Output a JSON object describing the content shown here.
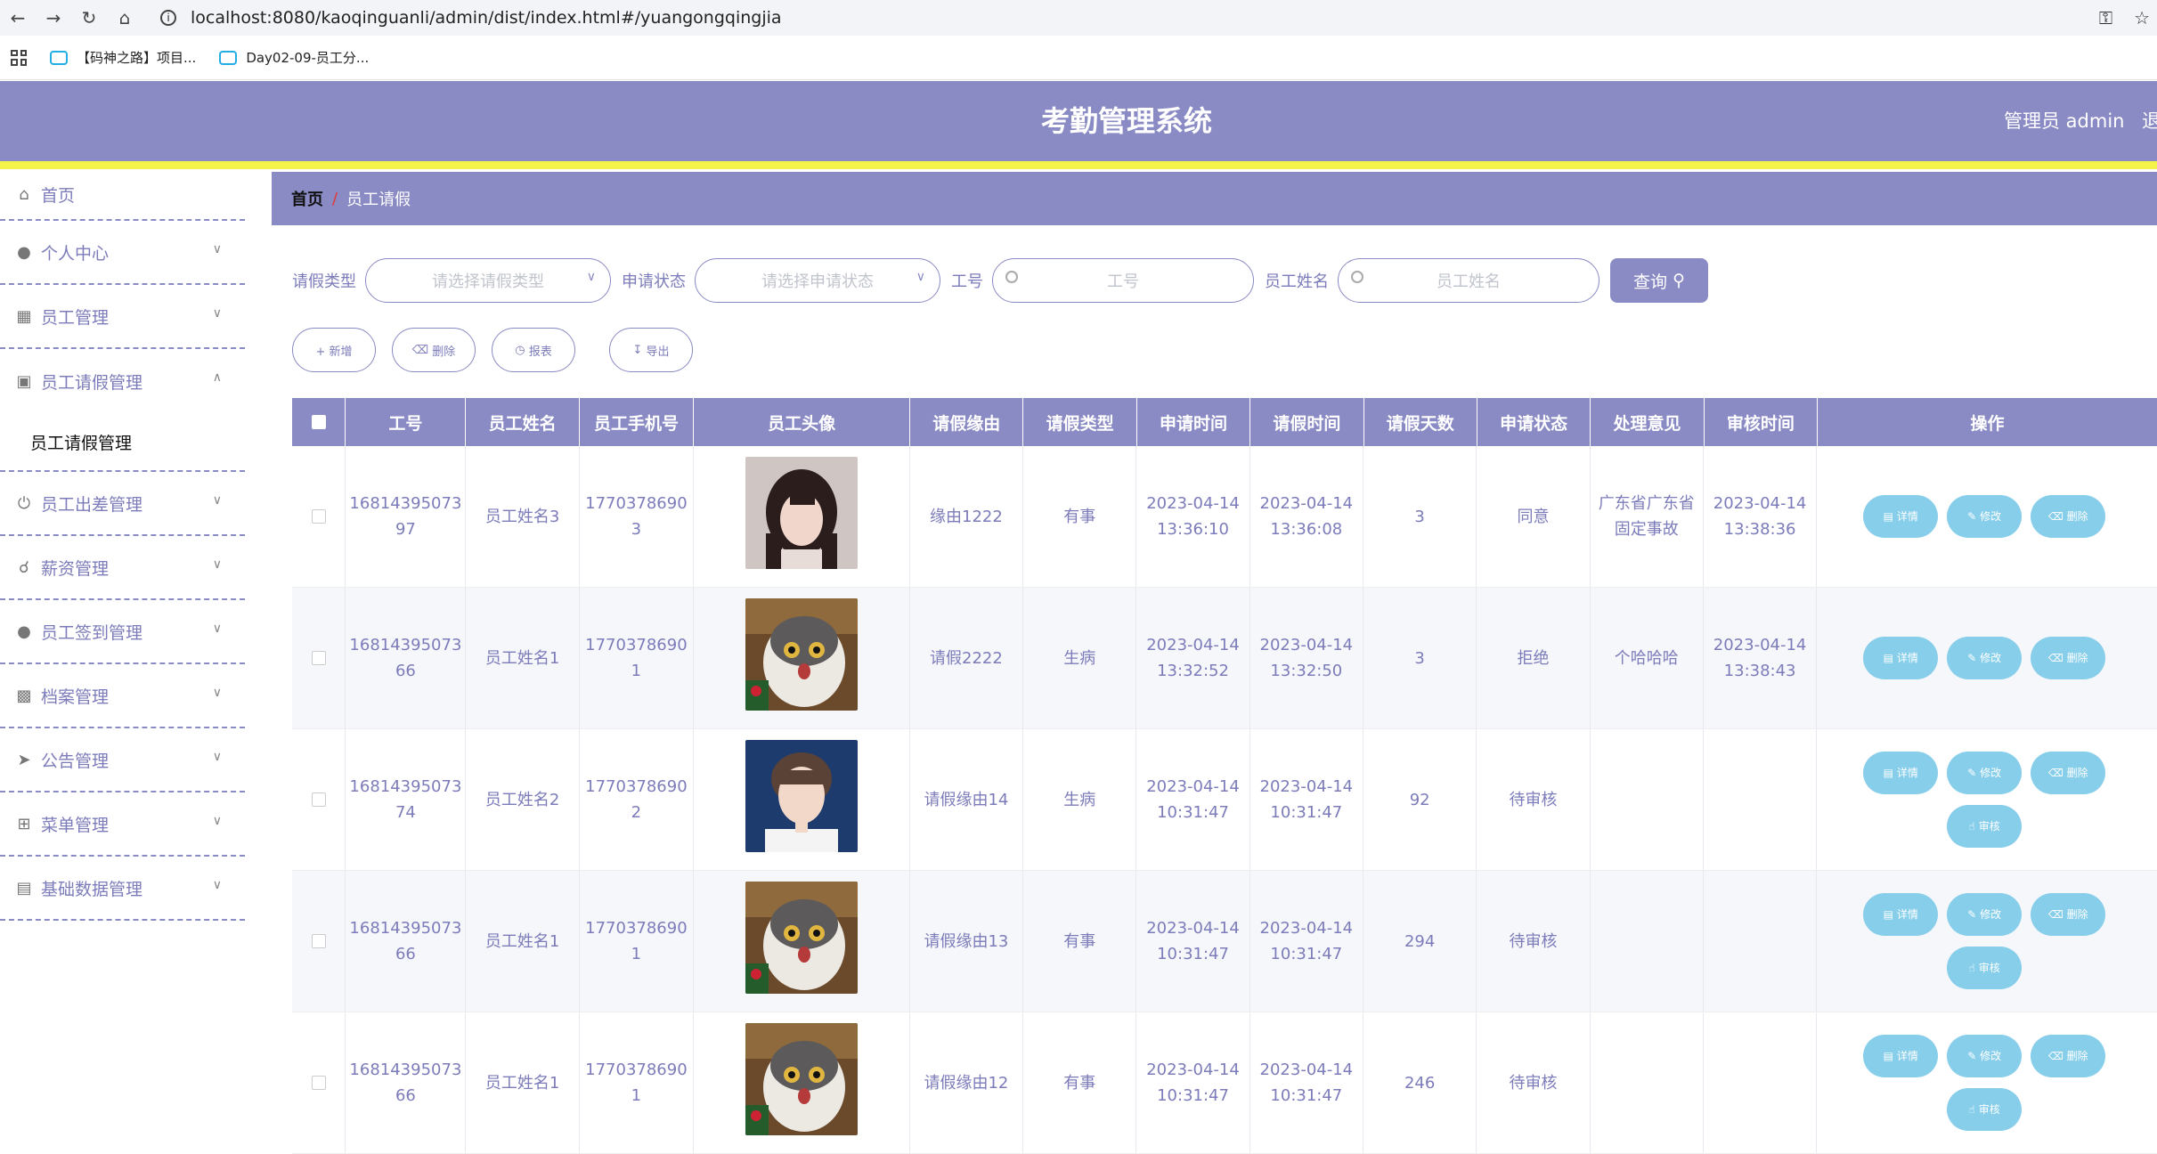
{
  "browser": {
    "url": "localhost:8080/kaoqinguanli/admin/dist/index.html#/yuangongqingjia",
    "bookmarks": [
      "【码神之路】项目...",
      "Day02-09-员工分..."
    ]
  },
  "header": {
    "title": "考勤管理系统",
    "admin": "管理员 admin",
    "logout": "退"
  },
  "sidebar": {
    "items": [
      {
        "label": "首页",
        "icon": "home-icon"
      },
      {
        "label": "个人中心",
        "icon": "user-icon"
      },
      {
        "label": "员工管理",
        "icon": "grid-icon"
      },
      {
        "label": "员工请假管理",
        "icon": "briefcase-icon"
      },
      {
        "label": "员工出差管理",
        "icon": "power-icon"
      },
      {
        "label": "薪资管理",
        "icon": "bell-off-icon"
      },
      {
        "label": "员工签到管理",
        "icon": "user-icon"
      },
      {
        "label": "档案管理",
        "icon": "printer-icon"
      },
      {
        "label": "公告管理",
        "icon": "send-icon"
      },
      {
        "label": "菜单管理",
        "icon": "crop-icon"
      },
      {
        "label": "基础数据管理",
        "icon": "clipboard-icon"
      }
    ],
    "submenu": "员工请假管理"
  },
  "breadcrumb": {
    "home": "首页",
    "sep": "/",
    "current": "员工请假"
  },
  "filters": {
    "type_label": "请假类型",
    "type_placeholder": "请选择请假类型",
    "status_label": "申请状态",
    "status_placeholder": "请选择申请状态",
    "id_label": "工号",
    "id_placeholder": "工号",
    "name_label": "员工姓名",
    "name_placeholder": "员工姓名",
    "query": "查询"
  },
  "actions": {
    "add": "+ 新增",
    "delete": "删除",
    "report": "报表",
    "export": "导出"
  },
  "table": {
    "headers": [
      "工号",
      "员工姓名",
      "员工手机号",
      "员工头像",
      "请假缘由",
      "请假类型",
      "申请时间",
      "请假时间",
      "请假天数",
      "申请状态",
      "处理意见",
      "审核时间",
      "操作"
    ],
    "ops": {
      "detail": "详情",
      "edit": "修改",
      "del": "删除",
      "audit": "审核"
    },
    "rows": [
      {
        "id": "1681439507397",
        "name": "员工姓名3",
        "phone": "17703786903",
        "avatar": "girl",
        "reason": "缘由1222",
        "type": "有事",
        "apply_time": "2023-04-14 13:36:10",
        "leave_time": "2023-04-14 13:36:08",
        "days": "3",
        "status": "同意",
        "opinion": "广东省广东省固定事故",
        "audit_time": "2023-04-14 13:38:36"
      },
      {
        "id": "1681439507366",
        "name": "员工姓名1",
        "phone": "17703786901",
        "avatar": "cat",
        "reason": "请假2222",
        "type": "生病",
        "apply_time": "2023-04-14 13:32:52",
        "leave_time": "2023-04-14 13:32:50",
        "days": "3",
        "status": "拒绝",
        "opinion": "个哈哈哈",
        "audit_time": "2023-04-14 13:38:43"
      },
      {
        "id": "1681439507374",
        "name": "员工姓名2",
        "phone": "17703786902",
        "avatar": "boy",
        "reason": "请假缘由14",
        "type": "生病",
        "apply_time": "2023-04-14 10:31:47",
        "leave_time": "2023-04-14 10:31:47",
        "days": "92",
        "status": "待审核",
        "opinion": "",
        "audit_time": ""
      },
      {
        "id": "1681439507366",
        "name": "员工姓名1",
        "phone": "17703786901",
        "avatar": "cat",
        "reason": "请假缘由13",
        "type": "有事",
        "apply_time": "2023-04-14 10:31:47",
        "leave_time": "2023-04-14 10:31:47",
        "days": "294",
        "status": "待审核",
        "opinion": "",
        "audit_time": ""
      },
      {
        "id": "1681439507366",
        "name": "员工姓名1",
        "phone": "17703786901",
        "avatar": "cat",
        "reason": "请假缘由12",
        "type": "有事",
        "apply_time": "2023-04-14 10:31:47",
        "leave_time": "2023-04-14 10:31:47",
        "days": "246",
        "status": "待审核",
        "opinion": "",
        "audit_time": ""
      }
    ]
  },
  "colors": {
    "primary": "#8a8ac4",
    "accent_bar": "#f3f34a",
    "op_button": "#87ceeb"
  }
}
